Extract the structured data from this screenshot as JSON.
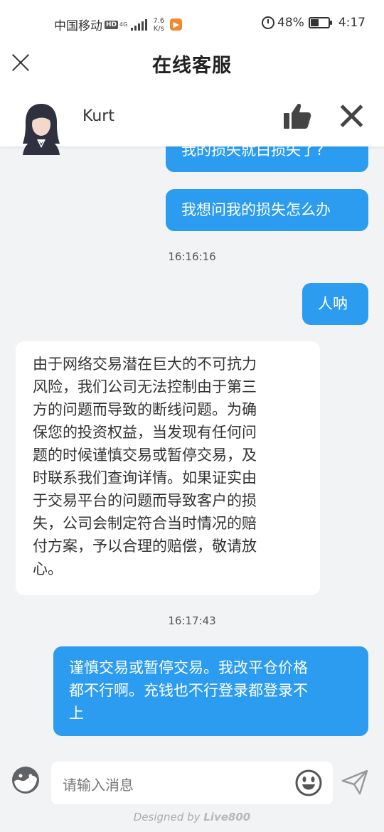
{
  "status_bar": {
    "carrier": "中国移动",
    "hd": "HD",
    "network": "4G",
    "speed_value": "7.6",
    "speed_unit": "K/s",
    "battery_percent": "48%",
    "battery_level": 0.48,
    "time": "4:17"
  },
  "nav": {
    "title": "在线客服"
  },
  "agent": {
    "name": "Kurt"
  },
  "messages": [
    {
      "side": "right",
      "text": "我的损失就白损失了?"
    },
    {
      "side": "right",
      "text": "我想问我的损失怎么办"
    },
    {
      "type": "timestamp",
      "text": "16:16:16"
    },
    {
      "side": "right",
      "text": "人呐"
    },
    {
      "side": "left",
      "lines": [
        "由于网络交易潜在巨大的不可抗力",
        "风险，我们公司无法控制由于第三",
        "方的问题而导致的断线问题。为确",
        "保您的投资权益，当发现有任何问",
        "题的时候谨慎交易或暂停交易，及",
        "时联系我们查询详情。如果证实由",
        "于交易平台的问题而导致客户的损",
        "失，公司会制定符合当时情况的赔",
        "付方案，予以合理的赔偿，敬请放",
        "心。"
      ]
    },
    {
      "type": "timestamp",
      "text": "16:17:43"
    },
    {
      "side": "right",
      "lines": [
        "谨慎交易或暂停交易。我改平仓价格",
        "都不行啊。充钱也不行登录都登录不",
        "上"
      ]
    }
  ],
  "input": {
    "placeholder": "请输入消息"
  },
  "footer": {
    "prefix": "Designed by ",
    "brand": "Live800"
  },
  "colors": {
    "bubble_right": "#2b9cf0",
    "bubble_left": "#ffffff",
    "background": "#f2f3f5"
  }
}
